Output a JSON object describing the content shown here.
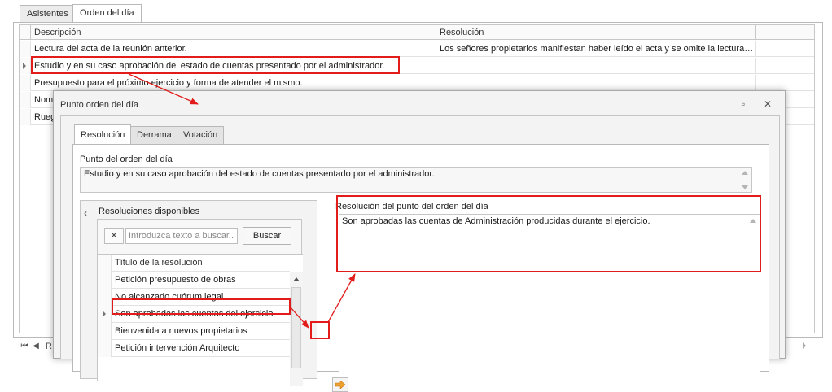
{
  "tabs": [
    "Asistentes",
    "Orden del día"
  ],
  "grid": {
    "headers": [
      "Descripción",
      "Resolución"
    ],
    "rows": [
      {
        "description": "Lectura del acta de la reunión anterior.",
        "resolution": "Los señores propietarios manifiestan haber leído el acta y se omite la lectura e..."
      },
      {
        "description": "Estudio y en su caso aprobación del estado de cuentas presentado por el administrador.",
        "resolution": ""
      },
      {
        "description": "Presupuesto para el próximo ejercicio y forma de atender el mismo.",
        "resolution": ""
      },
      {
        "description": "Nomb",
        "resolution": ""
      },
      {
        "description": "Rueg",
        "resolution": ""
      }
    ],
    "nav_partial": "R"
  },
  "dialog": {
    "title": "Punto orden del día",
    "tabs": [
      "Resolución",
      "Derrama",
      "Votación"
    ],
    "point_label": "Punto del orden del día",
    "point_text": "Estudio y en su caso aprobación del estado de cuentas presentado por el administrador.",
    "available_label": "Resoluciones disponibles",
    "search_placeholder": "Introduzca texto a buscar...",
    "search_button": "Buscar",
    "res_header": "Título de la resolución",
    "resolutions": [
      "Petición presupuesto de obras",
      "No alcanzado cuórum legal",
      "Son aprobadas las cuentas del ejercicio",
      "Bienvenida a nuevos propietarios",
      "Petición intervención Arquitecto"
    ],
    "resolution_label": "Resolución del punto del orden del día",
    "resolution_text": "Son aprobadas las cuentas de Administración producidas durante el ejercicio."
  },
  "colors": {
    "annotation": "#e21b1b",
    "arrow_button": "#f0a030"
  }
}
